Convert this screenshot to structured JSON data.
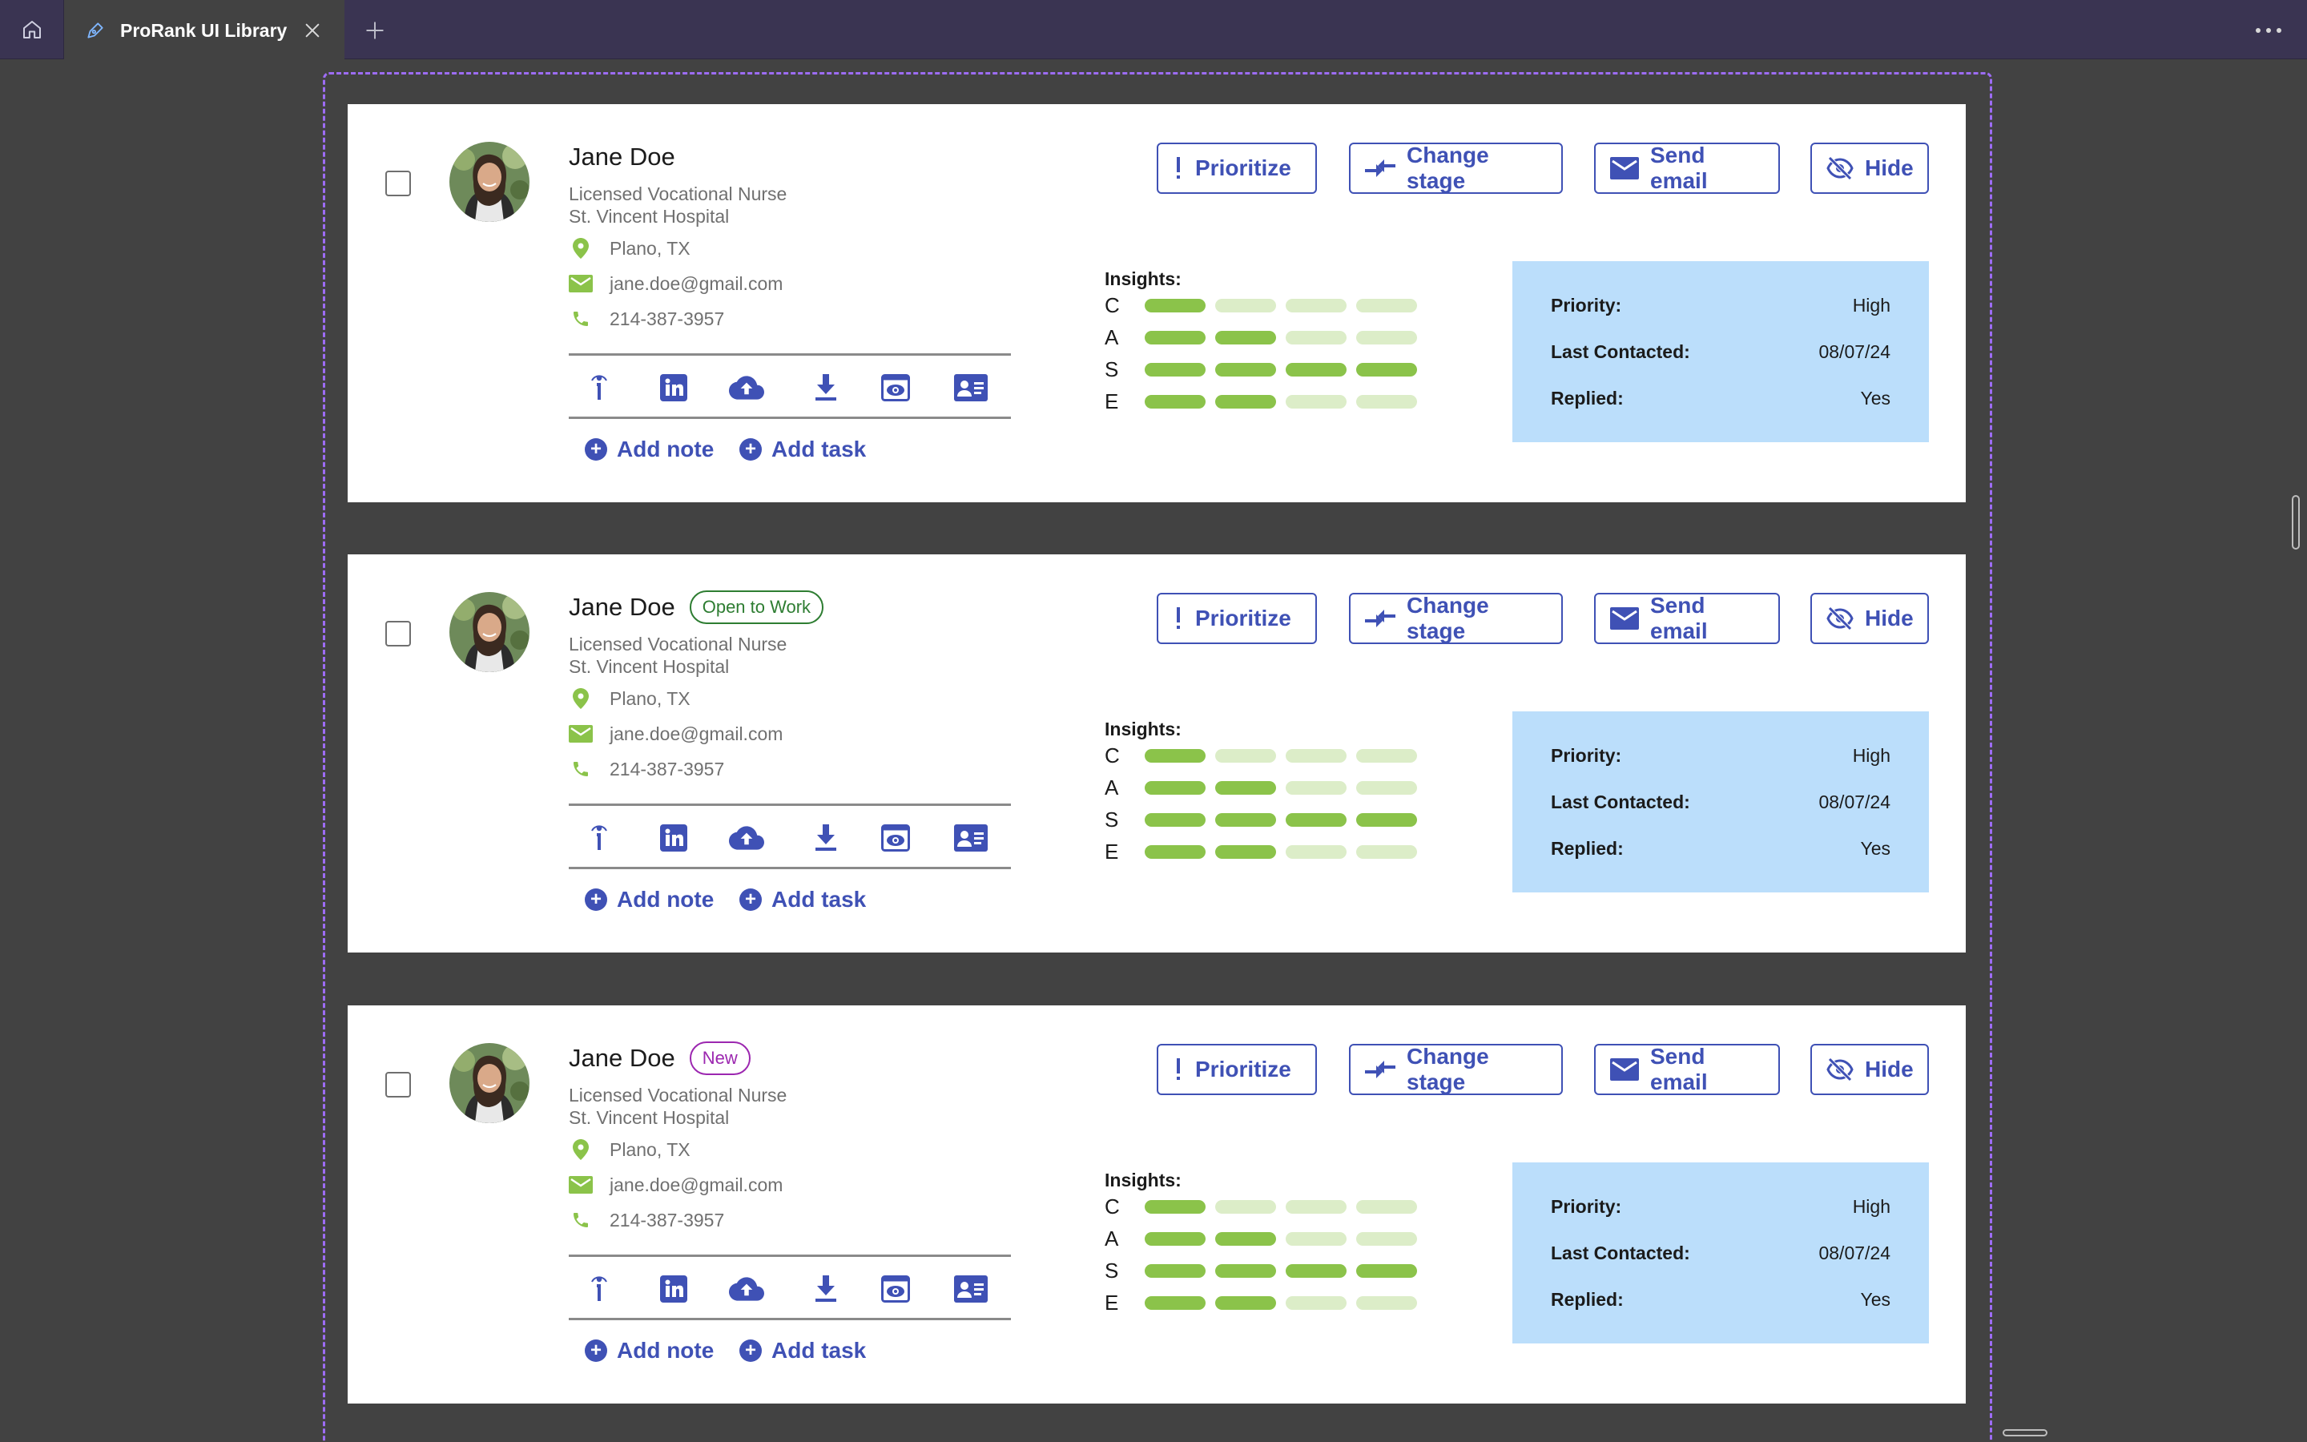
{
  "tab": {
    "title": "ProRank UI Library",
    "icon": "pen-icon"
  },
  "colors": {
    "accent": "#3f51b5",
    "insight_on": "#8bc34a",
    "insight_off": "#dcedc8",
    "info_bg": "#bbdefb",
    "badge_open": "#2e7d32",
    "badge_new": "#9c27b0",
    "frame_dash": "#9d6cf5"
  },
  "actions": {
    "prioritize": "Prioritize",
    "change_stage": "Change stage",
    "send_email": "Send email",
    "hide": "Hide"
  },
  "links": {
    "add_note": "Add note",
    "add_task": "Add task"
  },
  "insights_label": "Insights:",
  "info_labels": {
    "priority": "Priority:",
    "last_contacted": "Last Contacted:",
    "replied": "Replied:"
  },
  "toolbar_icons": [
    "info-icon",
    "linkedin-icon",
    "cloud-upload-icon",
    "download-icon",
    "preview-icon",
    "contact-card-icon"
  ],
  "candidates": [
    {
      "name": "Jane Doe",
      "badge": "",
      "title": "Licensed Vocational Nurse",
      "company": "St. Vincent Hospital",
      "location": "Plano, TX",
      "email": "jane.doe@gmail.com",
      "phone": "214-387-3957",
      "insights": [
        {
          "letter": "C",
          "level": 1
        },
        {
          "letter": "A",
          "level": 2
        },
        {
          "letter": "S",
          "level": 4
        },
        {
          "letter": "E",
          "level": 2
        }
      ],
      "priority": "High",
      "last_contacted": "08/07/24",
      "replied": "Yes"
    },
    {
      "name": "Jane Doe",
      "badge": "Open to Work",
      "title": "Licensed Vocational Nurse",
      "company": "St. Vincent Hospital",
      "location": "Plano, TX",
      "email": "jane.doe@gmail.com",
      "phone": "214-387-3957",
      "insights": [
        {
          "letter": "C",
          "level": 1
        },
        {
          "letter": "A",
          "level": 2
        },
        {
          "letter": "S",
          "level": 4
        },
        {
          "letter": "E",
          "level": 2
        }
      ],
      "priority": "High",
      "last_contacted": "08/07/24",
      "replied": "Yes"
    },
    {
      "name": "Jane Doe",
      "badge": "New",
      "title": "Licensed Vocational Nurse",
      "company": "St. Vincent Hospital",
      "location": "Plano, TX",
      "email": "jane.doe@gmail.com",
      "phone": "214-387-3957",
      "insights": [
        {
          "letter": "C",
          "level": 1
        },
        {
          "letter": "A",
          "level": 2
        },
        {
          "letter": "S",
          "level": 4
        },
        {
          "letter": "E",
          "level": 2
        }
      ],
      "priority": "High",
      "last_contacted": "08/07/24",
      "replied": "Yes"
    }
  ]
}
